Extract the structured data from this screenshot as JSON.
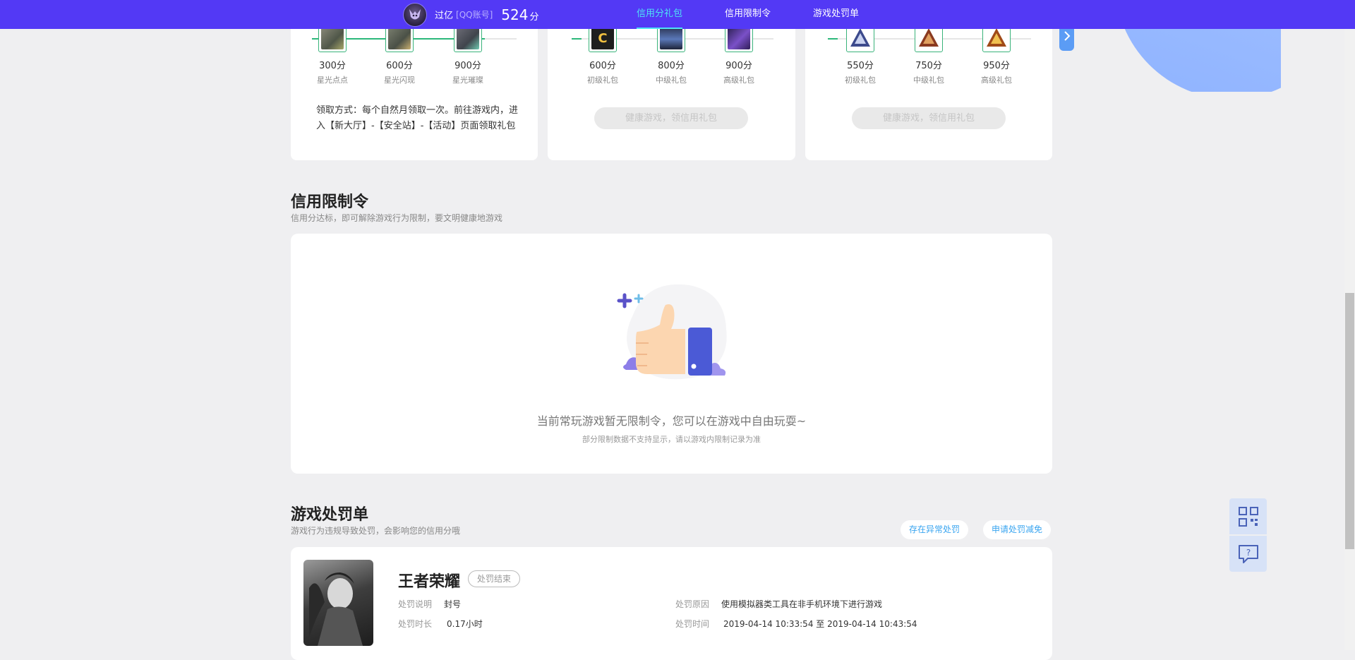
{
  "header": {
    "user_name": "过亿",
    "account_type": "[QQ账号]",
    "score": "524",
    "score_unit": "分",
    "tabs": [
      {
        "label": "信用分礼包",
        "active": true
      },
      {
        "label": "信用限制令",
        "active": false
      },
      {
        "label": "游戏处罚单",
        "active": false
      }
    ]
  },
  "gift_cards": [
    {
      "items": [
        {
          "score": "300分",
          "name": "星光点点",
          "icon": "star-gem-icon"
        },
        {
          "score": "600分",
          "name": "星光闪现",
          "icon": "star-armor-icon"
        },
        {
          "score": "900分",
          "name": "星光璀璨",
          "icon": "star-crystal-icon"
        }
      ],
      "note": "领取方式：每个自然月领取一次。前往游戏内，进入【新大厅】-【安全站】-【活动】页面领取礼包"
    },
    {
      "items": [
        {
          "score": "600分",
          "name": "初级礼包",
          "icon": "c-badge-icon"
        },
        {
          "score": "800分",
          "name": "中级礼包",
          "icon": "gun-icon"
        },
        {
          "score": "900分",
          "name": "高级礼包",
          "icon": "purple-weapon-icon"
        }
      ],
      "button": "健康游戏，领信用礼包"
    },
    {
      "items": [
        {
          "score": "550分",
          "name": "初级礼包",
          "icon": "silver-emblem-icon"
        },
        {
          "score": "750分",
          "name": "中级礼包",
          "icon": "bronze-emblem-icon"
        },
        {
          "score": "950分",
          "name": "高级礼包",
          "icon": "gold-emblem-icon"
        }
      ],
      "button": "健康游戏，领信用礼包"
    }
  ],
  "restriction": {
    "title": "信用限制令",
    "desc": "信用分达标，即可解除游戏行为限制，要文明健康地游戏",
    "empty_message": "当前常玩游戏暂无限制令，您可以在游戏中自由玩耍~",
    "empty_sub": "部分限制数据不支持显示，请以游戏内限制记录为准"
  },
  "penalty": {
    "title": "游戏处罚单",
    "desc": "游戏行为违规导致处罚，会影响您的信用分哦",
    "btn_abnormal": "存在异常处罚",
    "btn_appeal": "申请处罚减免",
    "record": {
      "game": "王者荣耀",
      "status": "处罚结束",
      "explain_label": "处罚说明",
      "explain_value": "封号",
      "duration_label": "处罚时长",
      "duration_value": "0.17小时",
      "reason_label": "处罚原因",
      "reason_value": "使用模拟器类工具在非手机环境下进行游戏",
      "time_label": "处罚时间",
      "time_value": "2019-04-14 10:33:54 至 2019-04-14 10:43:54"
    }
  },
  "colors": {
    "nav_bg": "#5339f5",
    "nav_active": "#4ee3f5",
    "progress_green": "#2cb87a",
    "link_blue": "#3aa5f0"
  }
}
